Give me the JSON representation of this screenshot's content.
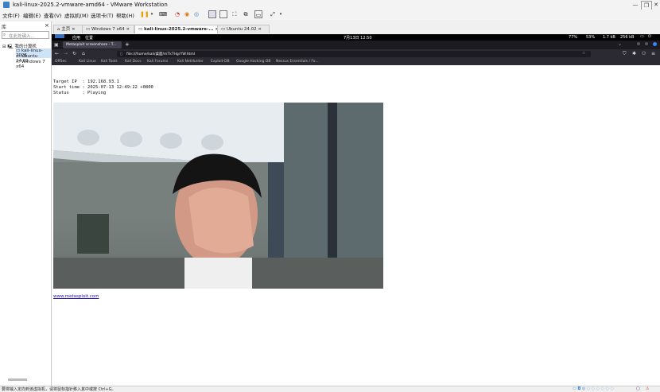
{
  "window": {
    "title": "kali-linux-2025.2-vmware-amd64 - VMware Workstation",
    "minimize": "—",
    "restore": "❐",
    "close": "✕"
  },
  "menu": [
    "文件(F)",
    "编辑(E)",
    "查看(V)",
    "虚拟机(M)",
    "选项卡(T)",
    "帮助(H)"
  ],
  "library": {
    "title": "库",
    "close": "×",
    "search_placeholder": "在此处键入...",
    "root": "我的计算机",
    "vms": [
      "kali-linux-2025",
      "Ubuntu 24.02",
      "Windows 7 x64"
    ]
  },
  "tabs": [
    {
      "label": "主页",
      "close": "×"
    },
    {
      "label": "Windows 7 x64",
      "close": "×"
    },
    {
      "label": "kali-linux-2025.2-vmware-...",
      "close": "×"
    },
    {
      "label": "Ubuntu 24.02",
      "close": "×"
    }
  ],
  "guest": {
    "topbar_left": [
      "应用",
      "位置"
    ],
    "clock": "7月13日 12:50",
    "topbar_right": [
      "77%",
      "53%",
      "1.7 kB",
      "256 kB"
    ],
    "browser_tab": "Metasploit screenshare - T...",
    "new_tab": "+",
    "url": "file:///home/kali/桌面/mTkTHgrYW.html",
    "bookmarks": [
      "OffSec",
      "Kali Linux",
      "Kali Tools",
      "Kali Docs",
      "Kali Forums",
      "Kali NetHunter",
      "Exploit-DB",
      "Google Hacking DB",
      "Nessus Essentials / Fo..."
    ],
    "page": {
      "target_ip": "Target IP  : 192.168.93.1",
      "start_time": "Start time : 2025-07-13 12:49:22 +0800",
      "status": "Status     : Playing",
      "link": "www.metasploit.com"
    }
  },
  "statusbar": {
    "message": "要将输入定向到该虚拟机，请将鼠标指针移入其中或按 Ctrl+G。"
  },
  "colors": {
    "accent": "#3b7fc4",
    "firefox_dark": "#2b2a33",
    "pause_icon": "#e8a000"
  }
}
